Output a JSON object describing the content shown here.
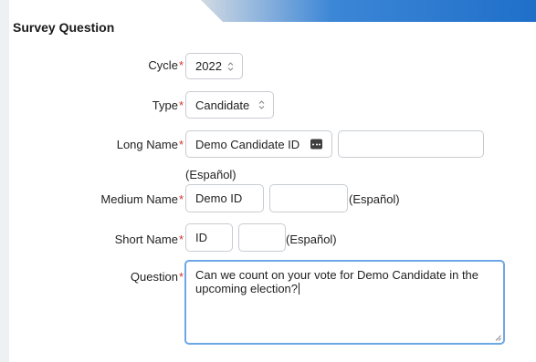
{
  "form": {
    "title": "Survey Question",
    "cycle": {
      "label": "Cycle",
      "required_mark": "*",
      "value": "2022"
    },
    "type": {
      "label": "Type",
      "required_mark": "*",
      "value": "Candidate"
    },
    "long_name": {
      "label": "Long Name",
      "required_mark": "*",
      "value": "Demo Candidate ID",
      "spanish_value": "",
      "spanish_label": "(Español)"
    },
    "medium_name": {
      "label": "Medium Name",
      "required_mark": "*",
      "value": "Demo ID",
      "spanish_value": "",
      "spanish_label": "(Español)"
    },
    "short_name": {
      "label": "Short Name",
      "required_mark": "*",
      "value": "ID",
      "spanish_value": "",
      "spanish_label": "(Español)"
    },
    "question": {
      "label": "Question",
      "required_mark": "*",
      "value": "Can we count on your vote for Demo Candidate in the upcoming election?"
    }
  },
  "icons": {
    "select_arrow": "chevron-up-down-icon",
    "autofill": "more-dots-icon",
    "resize": "resize-grip-icon"
  },
  "colors": {
    "required": "#d0342c",
    "focus_border": "#6ea7e6",
    "banner_blue": "#1f6fc9"
  }
}
